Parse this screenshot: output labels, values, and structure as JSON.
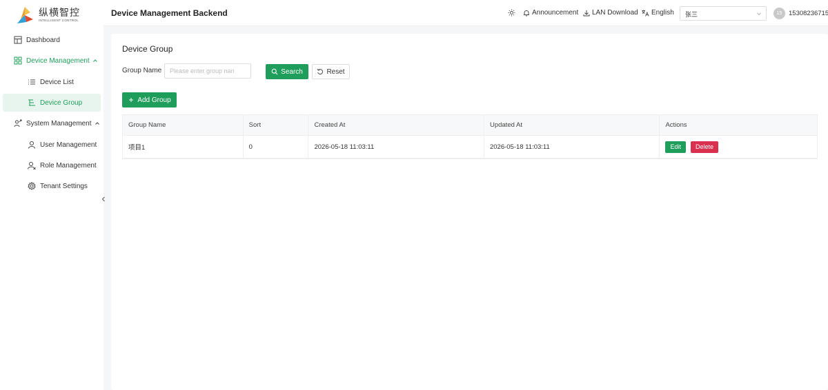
{
  "brand": {
    "name_cn": "纵横智控",
    "name_en": "INTELLIGENT CONTROL"
  },
  "sidebar": {
    "items": [
      {
        "label": "Dashboard",
        "icon": "dashboard-icon"
      },
      {
        "label": "Device Management",
        "icon": "device-management-icon",
        "expanded": true
      },
      {
        "label": "Device List",
        "icon": "list-icon"
      },
      {
        "label": "Device Group",
        "icon": "group-icon",
        "active": true
      },
      {
        "label": "System Management",
        "icon": "system-management-icon",
        "expanded": true
      },
      {
        "label": "User Management",
        "icon": "user-icon"
      },
      {
        "label": "Role Management",
        "icon": "role-icon"
      },
      {
        "label": "Tenant Settings",
        "icon": "gear-icon"
      }
    ]
  },
  "header": {
    "title": "Device Management Backend",
    "theme_icon": "sun-icon",
    "announcement": "Announcement",
    "lan_download": "LAN Download",
    "language": "English",
    "user_select_value": "张三",
    "avatar_text": "15",
    "phone": "15308236715"
  },
  "main": {
    "title": "Device Group",
    "filter": {
      "label": "Group Name",
      "placeholder": "Please enter group nan",
      "value": ""
    },
    "search_label": "Search",
    "reset_label": "Reset",
    "add_label": "Add Group",
    "table": {
      "columns": [
        "Group Name",
        "Sort",
        "Created At",
        "Updated At",
        "Actions"
      ],
      "rows": [
        {
          "group_name": "项目1",
          "sort": "0",
          "created_at": "2026-05-18 11:03:11",
          "updated_at": "2026-05-18 11:03:11",
          "edit_label": "Edit",
          "delete_label": "Delete"
        }
      ]
    }
  },
  "colors": {
    "accent": "#1e9e5a",
    "danger": "#d9304f",
    "active_bg": "#e8f5ee"
  }
}
